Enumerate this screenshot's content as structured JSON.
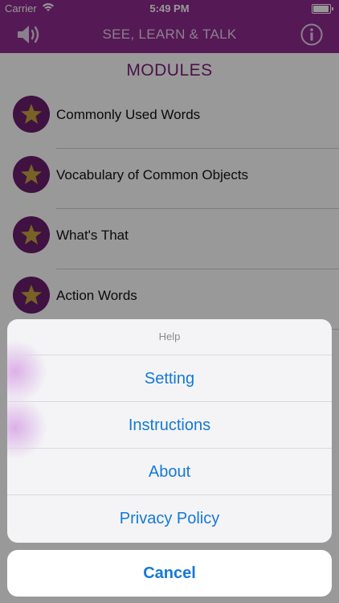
{
  "status_bar": {
    "carrier": "Carrier",
    "time": "5:49 PM"
  },
  "nav": {
    "title": "SEE, LEARN & TALK",
    "left_icon": "speaker-icon",
    "right_icon": "info-icon"
  },
  "page": {
    "title": "MODULES"
  },
  "modules": [
    {
      "label": "Commonly Used Words",
      "icon": "star-icon"
    },
    {
      "label": "Vocabulary of Common Objects",
      "icon": "star-icon"
    },
    {
      "label": "What's That",
      "icon": "star-icon"
    },
    {
      "label": "Action Words",
      "icon": "star-icon"
    }
  ],
  "action_sheet": {
    "title": "Help",
    "actions": [
      "Setting",
      "Instructions",
      "About",
      "Privacy Policy"
    ],
    "cancel": "Cancel"
  },
  "colors": {
    "brand_purple": "#8e2a8e",
    "badge_purple": "#6a1e6e",
    "star_gold": "#c9a43f",
    "action_blue": "#1479d6"
  }
}
